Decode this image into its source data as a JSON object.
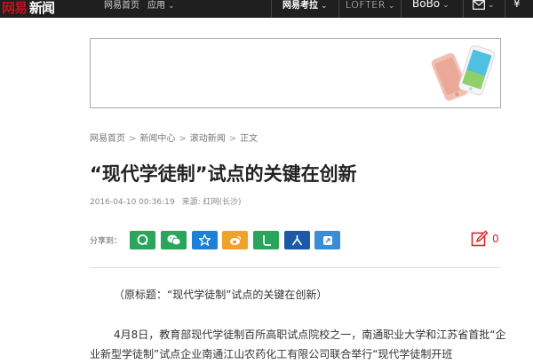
{
  "topbar": {
    "logo_part1": "网易",
    "logo_part2": "新闻",
    "home_label": "网易首页",
    "app_label": "应用",
    "exam_label": "网易考拉",
    "lofter_label": "LOFTER",
    "bobo_label": "BoBo",
    "currency_label": "¥"
  },
  "breadcrumb": {
    "items": [
      "网易首页",
      "新闻中心",
      "滚动新闻",
      "正文"
    ],
    "separator": ">"
  },
  "article": {
    "title": "“现代学徒制”试点的关键在创新",
    "date": "2016-04-10 00:36:19",
    "source": "来源: 红网(长沙)",
    "paragraphs": [
      "（原标题：“现代学徒制”试点的关键在创新）",
      "4月8日，教育部现代学徒制百所高职试点院校之一，南通职业大学和江苏省首批“企业新型学徒制”试点企业南通江山农药化工有限公司联合举行“现代学徒制开班"
    ]
  },
  "share": {
    "label": "分享到：",
    "buttons": [
      {
        "name": "qq",
        "color": "#2aa55b"
      },
      {
        "name": "wechat",
        "color": "#2aa55b"
      },
      {
        "name": "qzone",
        "color": "#1d7fd6"
      },
      {
        "name": "weibo",
        "color": "#f0a22b"
      },
      {
        "name": "yixin",
        "color": "#2aa55b"
      },
      {
        "name": "renren",
        "color": "#1c5aa8"
      },
      {
        "name": "youdao",
        "color": "#3a8ed6"
      }
    ]
  },
  "comment": {
    "count": "0",
    "color": "#d12a2a"
  }
}
